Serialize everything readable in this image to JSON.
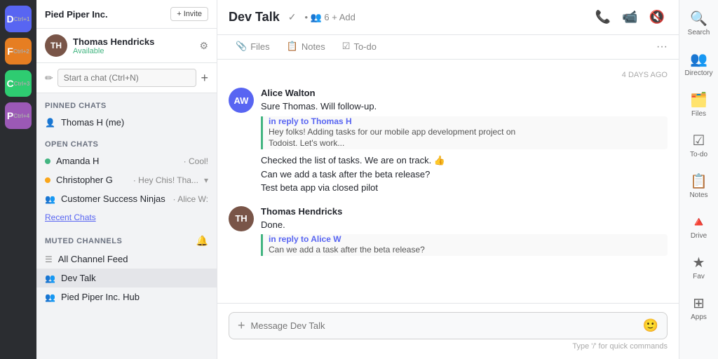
{
  "iconBar": {
    "items": [
      {
        "id": "chat1",
        "label": "D",
        "sublabel": "Ctrl+1",
        "type": "avatar",
        "color": "#5865f2"
      },
      {
        "id": "chat2",
        "label": "F",
        "sublabel": "Ctrl+2",
        "type": "avatar",
        "color": "#e67e22"
      },
      {
        "id": "chat3",
        "label": "C",
        "sublabel": "Ctrl+3",
        "type": "avatar",
        "color": "#2ecc71"
      },
      {
        "id": "chat4",
        "label": "P",
        "sublabel": "Ctrl+4",
        "type": "avatar",
        "color": "#9b59b6",
        "active": true
      }
    ]
  },
  "sidebar": {
    "company": "Pied Piper Inc.",
    "invite_button": "+ Invite",
    "user": {
      "name": "Thomas Hendricks",
      "status": "Available"
    },
    "new_chat_placeholder": "Start a chat (Ctrl+N)",
    "pinned_section": "PINNED CHATS",
    "pinned_items": [
      {
        "name": "Thomas H (me)",
        "icon": "👤"
      }
    ],
    "open_section": "OPEN CHATS",
    "open_items": [
      {
        "name": "Amanda H",
        "preview": " Cool!",
        "dot": "green"
      },
      {
        "name": "Christopher G",
        "preview": " Hey Chis! Tha...",
        "dot": "orange",
        "has_chevron": true
      },
      {
        "name": "Customer Success Ninjas",
        "preview": " Alice W:",
        "icon": "👥"
      }
    ],
    "recent_chats": "Recent Chats",
    "muted_section": "MUTED CHANNELS",
    "muted_items": [
      {
        "name": "All Channel Feed",
        "icon": "☰"
      },
      {
        "name": "Dev Talk",
        "icon": "👥",
        "active": true
      },
      {
        "name": "Pied Piper Inc. Hub",
        "icon": "👥"
      }
    ]
  },
  "chat": {
    "title": "Dev Talk",
    "verified_icon": "✓",
    "members_count": "• 👥 6  + Add",
    "tabs": [
      {
        "label": "Files",
        "icon": "📎"
      },
      {
        "label": "Notes",
        "icon": "📋"
      },
      {
        "label": "To-do",
        "icon": "☑"
      }
    ],
    "date_divider": "4 DAYS AGO",
    "messages": [
      {
        "sender": "Alice Walton",
        "avatar_initials": "AW",
        "avatar_color": "#5865f2",
        "text": "Sure Thomas. Will follow-up.",
        "reply": {
          "author": "in reply to Thomas H",
          "lines": [
            "Hey folks! Adding tasks for our mobile app development project on",
            "Todoist. Let's work..."
          ]
        },
        "extra_lines": [
          "Checked the list of tasks. We are on track. 👍",
          "Can we add a task after the beta release?",
          "Test beta app via closed pilot"
        ]
      },
      {
        "sender": "Thomas Hendricks",
        "avatar_initials": "TH",
        "avatar_color": "#795548",
        "text": "Done.",
        "reply": {
          "author": "in reply to Alice W",
          "lines": [
            "Can we add a task after the beta release?"
          ]
        }
      }
    ],
    "input_placeholder": "Message Dev Talk",
    "quick_cmd_hint": "Type '/' for quick commands"
  },
  "rightNav": {
    "items": [
      {
        "label": "Search",
        "icon": "🔍",
        "id": "search"
      },
      {
        "label": "Directory",
        "icon": "👥",
        "id": "directory"
      },
      {
        "label": "Files",
        "icon": "🗂️",
        "id": "files"
      },
      {
        "label": "To-do",
        "icon": "☑",
        "id": "todo"
      },
      {
        "label": "Notes",
        "icon": "📋",
        "id": "notes"
      },
      {
        "label": "Drive",
        "icon": "🔺",
        "id": "drive"
      },
      {
        "label": "Fav",
        "icon": "★",
        "id": "fav"
      },
      {
        "label": "Apps",
        "icon": "⊞",
        "id": "apps"
      }
    ]
  }
}
